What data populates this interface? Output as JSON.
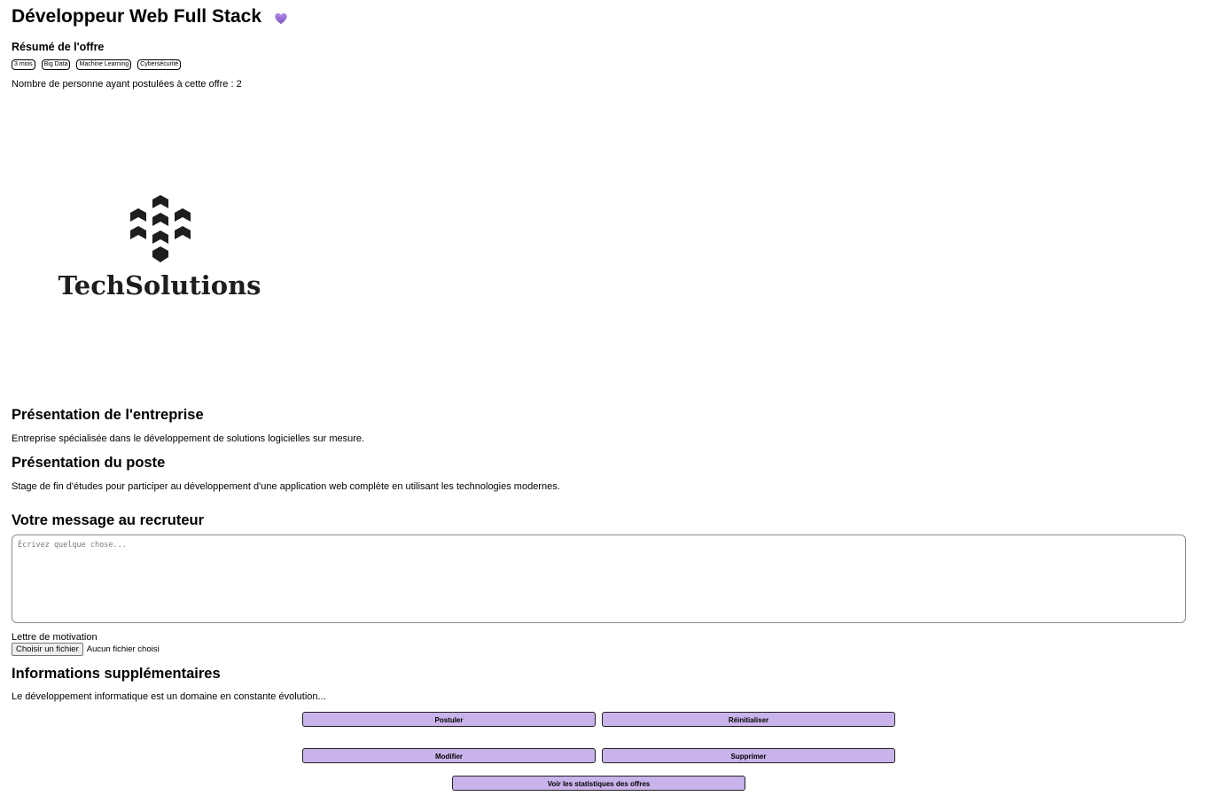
{
  "offer": {
    "title": "Développeur Web Full Stack",
    "favorite_icon": "heart-icon",
    "favorite_color": "#9b6fd4",
    "summary_title": "Résumé de l'offre",
    "tags": [
      "3 mois",
      "Big Data",
      "Machine Learning",
      "Cybersécurité"
    ],
    "applicants_text": "Nombre de personne ayant postulées à cette offre : 2"
  },
  "company": {
    "logo_name": "TechSolutions",
    "presentation_title": "Présentation de l'entreprise",
    "presentation_text": "Entreprise spécialisée dans le développement de solutions logicielles sur mesure."
  },
  "position": {
    "title": "Présentation du poste",
    "text": "Stage de fin d'études pour participer au développement d'une application web complète en utilisant les technologies modernes."
  },
  "message": {
    "title": "Votre message au recruteur",
    "placeholder": "Écrivez quelque chose...",
    "value": ""
  },
  "motivation": {
    "label": "Lettre de motivation",
    "button_label": "Choisir un fichier",
    "status": "Aucun fichier choisi"
  },
  "extra": {
    "title": "Informations supplémentaires",
    "text": "Le développement informatique est un domaine en constante évolution..."
  },
  "actions": {
    "apply": "Postuler",
    "reset": "Réinitialiser",
    "edit": "Modifier",
    "delete": "Supprimer",
    "stats": "Voir les statistiques des offres",
    "button_color": "#c8b3ea"
  }
}
